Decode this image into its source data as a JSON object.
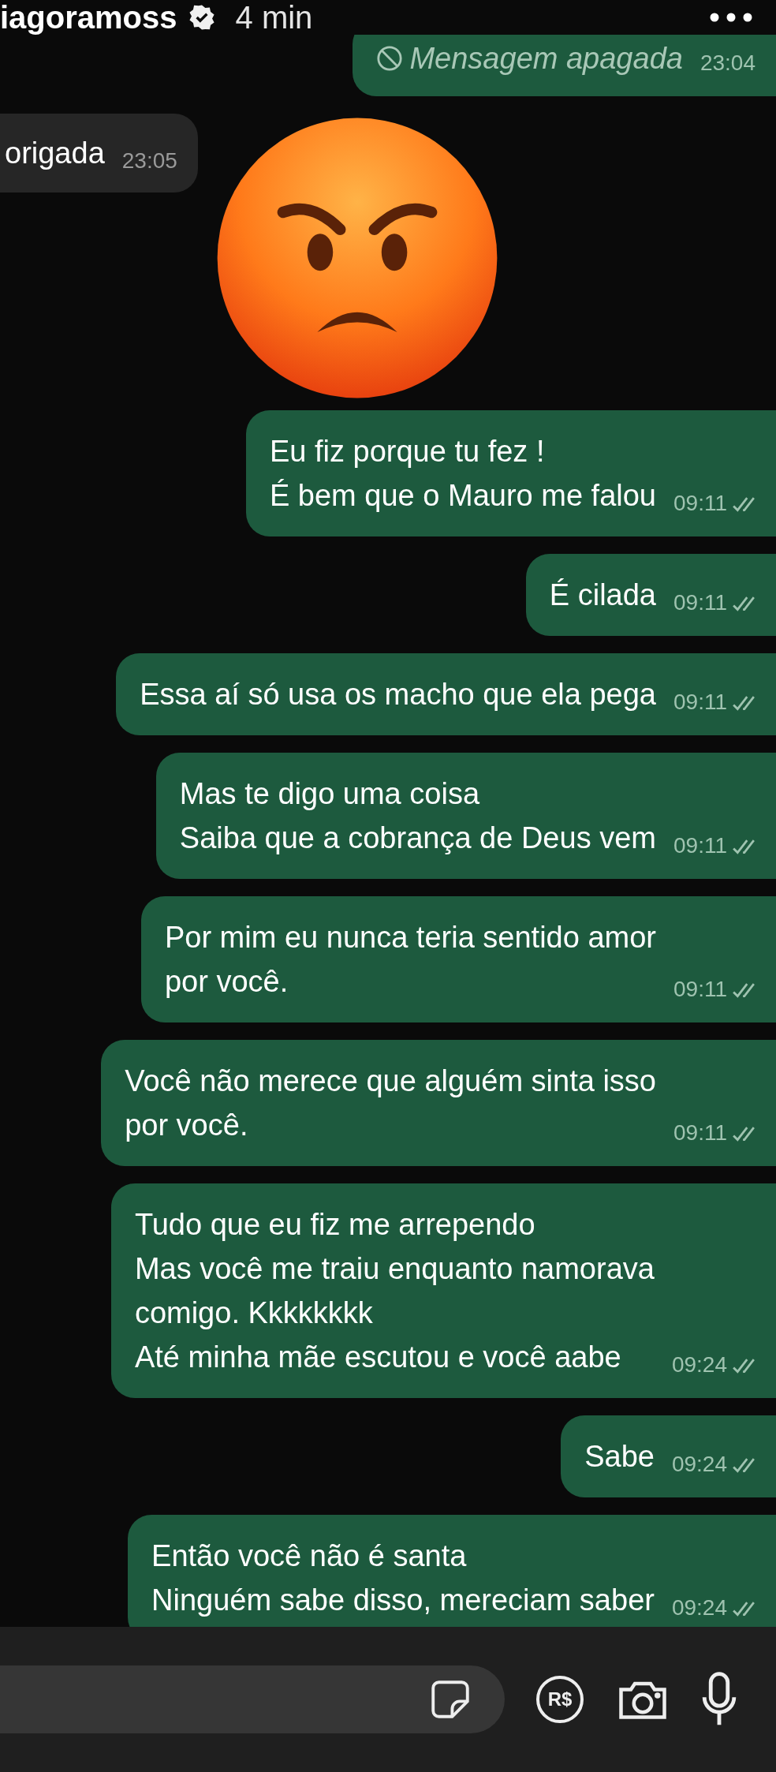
{
  "header": {
    "username": "iagoramoss",
    "verified": true,
    "time": "4 min"
  },
  "messages": [
    {
      "kind": "deleted",
      "outgoing": true,
      "lines": [
        "Mensagem apagada"
      ],
      "time": "23:04"
    },
    {
      "kind": "text",
      "outgoing": false,
      "lines": [
        "origada"
      ],
      "time": "23:05"
    },
    {
      "kind": "text",
      "outgoing": true,
      "lines": [
        "Eu fiz porque tu fez !",
        "É bem que o Mauro me falou"
      ],
      "time": "09:11"
    },
    {
      "kind": "text",
      "outgoing": true,
      "lines": [
        "É cilada"
      ],
      "time": "09:11"
    },
    {
      "kind": "text",
      "outgoing": true,
      "lines": [
        "Essa aí só usa os macho que ela pega"
      ],
      "time": "09:11"
    },
    {
      "kind": "text",
      "outgoing": true,
      "lines": [
        "Mas te digo uma coisa",
        "Saiba que a cobrança de Deus vem"
      ],
      "time": "09:11"
    },
    {
      "kind": "text",
      "outgoing": true,
      "lines": [
        "Por mim eu nunca teria sentido amor",
        "por você."
      ],
      "time": "09:11"
    },
    {
      "kind": "text",
      "outgoing": true,
      "lines": [
        "Você não merece que alguém sinta isso",
        "por você."
      ],
      "time": "09:11"
    },
    {
      "kind": "text",
      "outgoing": true,
      "lines": [
        "Tudo que eu fiz me arrependo",
        "Mas você me traiu enquanto namorava",
        "comigo. Kkkkkkkk",
        "Até minha mãe escutou e você aabe"
      ],
      "time": "09:24"
    },
    {
      "kind": "text",
      "outgoing": true,
      "lines": [
        "Sabe"
      ],
      "time": "09:24"
    },
    {
      "kind": "text",
      "outgoing": true,
      "lines": [
        "Então você não é santa",
        "Ninguém sabe disso, mereciam saber"
      ],
      "time": "09:24"
    }
  ],
  "input_bar": {
    "payment_label": "R$"
  }
}
